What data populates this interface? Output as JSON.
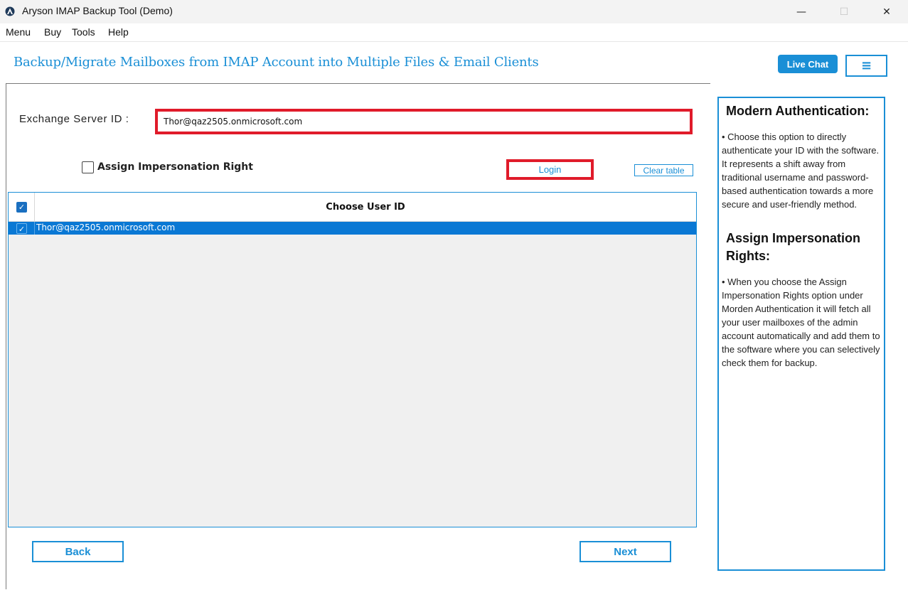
{
  "window": {
    "title": "Aryson IMAP Backup Tool (Demo)",
    "minimize_glyph": "—",
    "maximize_glyph": "☐",
    "close_glyph": "✕"
  },
  "menu": {
    "items": [
      "Menu",
      "Buy",
      "Tools",
      "Help"
    ]
  },
  "header": {
    "title": "Backup/Migrate Mailboxes from IMAP Account into Multiple Files & Email Clients",
    "live_chat_label": "Live Chat",
    "hamburger_glyph": "≡"
  },
  "form": {
    "exchange_label": "Exchange Server ID :",
    "exchange_value": "Thor@qaz2505.onmicrosoft.com",
    "impersonation_label": "Assign Impersonation Right",
    "impersonation_checked": false,
    "login_label": "Login",
    "clear_label": "Clear table"
  },
  "table": {
    "column_header": "Choose User ID",
    "header_checked": true,
    "check_glyph": "✓",
    "rows": [
      {
        "user_id": "Thor@qaz2505.onmicrosoft.com",
        "checked": true,
        "selected": true
      }
    ]
  },
  "navigation": {
    "back_label": "Back",
    "next_label": "Next"
  },
  "side_panel": {
    "heading1": "Modern Authentication:",
    "para1": "•  Choose this option to directly authenticate your ID with the software. It represents a shift away from traditional username and password-based authentication towards a more secure and user-friendly method.",
    "heading2": "Assign Impersonation Rights:",
    "para2": "•  When you choose the Assign Impersonation Rights option under Morden Authentication it will fetch all your user mailboxes of the admin account automatically and add them to the software where you can selectively check them for backup."
  },
  "colors": {
    "accent": "#1a8fd6",
    "highlight_red": "#e01b2a",
    "selected_row": "#0a78d4"
  }
}
